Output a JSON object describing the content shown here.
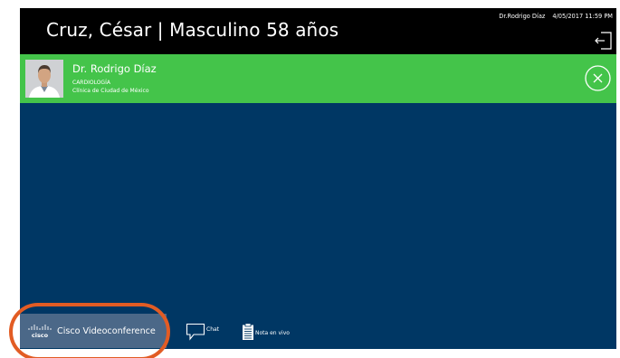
{
  "header": {
    "patient_title": "Cruz, César | Masculino 58 años",
    "user": "Dr.Rodrigo Díaz",
    "datetime": "4/05/2017 11:59 PM",
    "logout_icon": "logout-icon"
  },
  "doctor": {
    "name": "Dr. Rodrigo Díaz",
    "specialty": "CARDIOLOGÍA",
    "clinic": "Clínica de Ciudad de México",
    "close_icon": "close-circle-icon"
  },
  "toolbar": {
    "cisco_label": "Cisco Videoconference",
    "cisco_logo_text": "cisco",
    "chat_label": "Chat",
    "note_label": "Nota en vivo"
  },
  "colors": {
    "header_bg": "#000000",
    "doctor_bar_bg": "#44c44a",
    "video_bg": "#003764",
    "cisco_button_bg": "#4b6888",
    "highlight": "#e25c24"
  }
}
